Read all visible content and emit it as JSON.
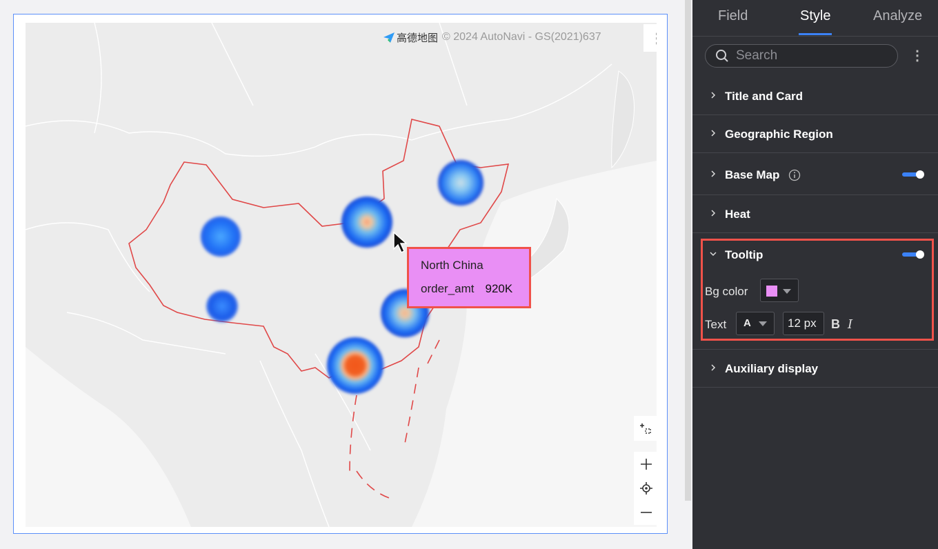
{
  "map": {
    "attribution_logo_text": "高德地图",
    "attribution_text": "© 2024 AutoNavi - GS(2021)637",
    "more_menu_icon": "more-vertical-icon",
    "tooltip": {
      "title": "North China",
      "field": "order_amt",
      "value": "920K",
      "bg_color": "#e98ff5"
    },
    "heat_spots": [
      {
        "intensity": 0.2
      },
      {
        "intensity": 0.55
      },
      {
        "intensity": 0.15
      },
      {
        "intensity": 0.1
      },
      {
        "intensity": 0.45
      },
      {
        "intensity": 1.0
      }
    ],
    "controls": [
      "fit-view-icon",
      "zoom-in-icon",
      "locate-icon",
      "zoom-out-icon"
    ]
  },
  "panel": {
    "tabs": [
      {
        "label": "Field",
        "active": false
      },
      {
        "label": "Style",
        "active": true
      },
      {
        "label": "Analyze",
        "active": false
      }
    ],
    "search_placeholder": "Search",
    "sections": [
      {
        "title": "Title and Card",
        "expanded": false
      },
      {
        "title": "Geographic Region",
        "expanded": false
      },
      {
        "title": "Base Map",
        "expanded": false,
        "toggle": true
      },
      {
        "title": "Heat",
        "expanded": false
      },
      {
        "title": "Tooltip",
        "expanded": true,
        "toggle": true
      },
      {
        "title": "Auxiliary display",
        "expanded": false
      }
    ],
    "tooltip_settings": {
      "bg_color_label": "Bg color",
      "bg_color_value": "#e98ff5",
      "text_label": "Text",
      "font_color_glyph": "A",
      "font_size": "12 px",
      "bold_glyph": "B",
      "italic_glyph": "I"
    }
  },
  "colors": {
    "accent": "#3b82f6",
    "highlight_border": "#f0524a",
    "card_border": "#5b8ff9",
    "panel_bg": "#2f3035"
  }
}
